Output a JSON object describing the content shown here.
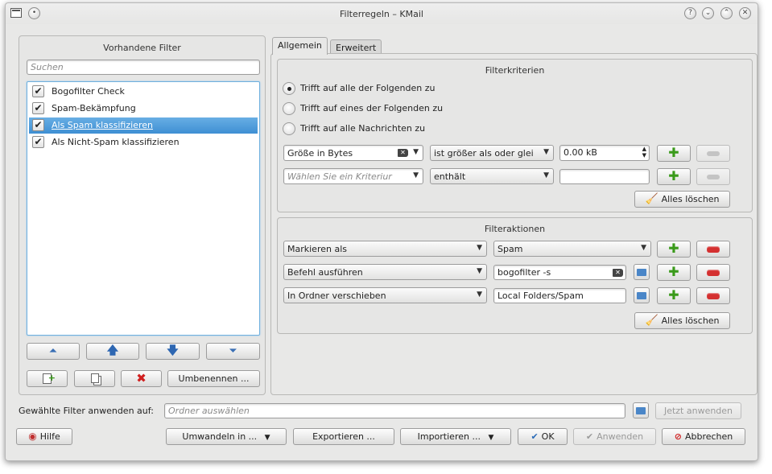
{
  "window": {
    "title": "Filterregeln – KMail"
  },
  "left": {
    "section_title": "Vorhandene Filter",
    "search_placeholder": "Suchen",
    "filters": [
      {
        "label": "Bogofilter Check",
        "checked": true,
        "selected": false
      },
      {
        "label": "Spam-Bekämpfung",
        "checked": true,
        "selected": false
      },
      {
        "label": "Als Spam klassifizieren",
        "checked": true,
        "selected": true
      },
      {
        "label": "Als Nicht-Spam klassifizieren",
        "checked": true,
        "selected": false
      }
    ],
    "rename_label": "Umbenennen ..."
  },
  "tabs": [
    {
      "label": "Allgemein",
      "active": true
    },
    {
      "label": "Erweitert",
      "active": false
    }
  ],
  "criteria": {
    "section_title": "Filterkriterien",
    "radio_options": [
      {
        "label": "Trifft auf alle der Folgenden zu",
        "checked": true
      },
      {
        "label": "Trifft auf eines der Folgenden zu",
        "checked": false
      },
      {
        "label": "Trifft auf alle Nachrichten zu",
        "checked": false
      }
    ],
    "rows": [
      {
        "field": "Größe in Bytes",
        "operator": "ist größer als oder glei",
        "value": "0.00 kB"
      },
      {
        "field_placeholder": "Wählen Sie ein Kriteriur",
        "operator": "enthält",
        "value": ""
      }
    ],
    "clear_all_label": "Alles löschen"
  },
  "actions": {
    "section_title": "Filteraktionen",
    "rows": [
      {
        "action": "Markieren als",
        "value": "Spam"
      },
      {
        "action": "Befehl ausführen",
        "value": "bogofilter -s"
      },
      {
        "action": "In Ordner verschieben",
        "value": "Local Folders/Spam"
      }
    ],
    "clear_all_label": "Alles löschen"
  },
  "apply": {
    "label": "Gewählte Filter anwenden auf:",
    "folder_placeholder": "Ordner auswählen",
    "apply_now_label": "Jetzt anwenden"
  },
  "footer": {
    "help": "Hilfe",
    "convert": "Umwandeln in ...",
    "export": "Exportieren ...",
    "import": "Importieren ...",
    "ok": "OK",
    "apply": "Anwenden",
    "cancel": "Abbrechen"
  }
}
